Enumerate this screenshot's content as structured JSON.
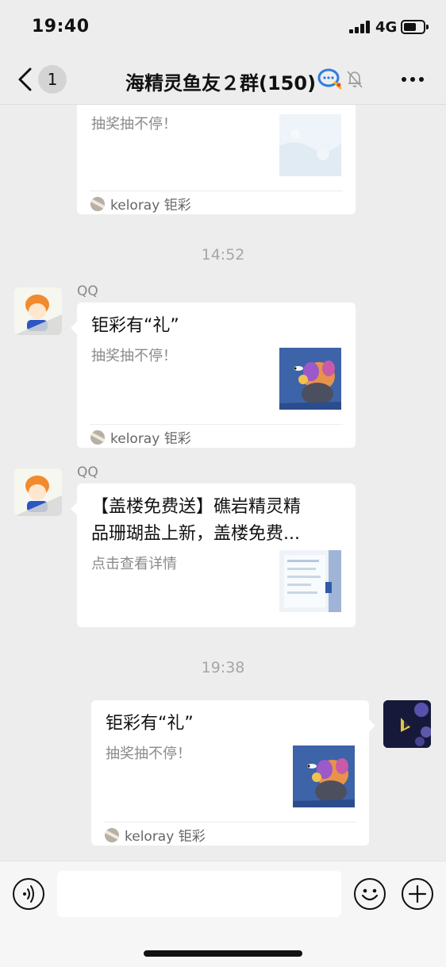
{
  "status_bar": {
    "time": "19:40",
    "network": "4G"
  },
  "nav": {
    "back_badge": "1",
    "title": "海精灵鱼友２群(150)"
  },
  "chat": {
    "messages": [
      {
        "kind": "card-partial",
        "desc": "抽奖抽不停！",
        "footer": "keloray 钜彩"
      },
      {
        "kind": "time",
        "text": "14:52"
      },
      {
        "kind": "card",
        "sender": "QQ",
        "title": "钜彩有“礼”",
        "desc": "抽奖抽不停！",
        "footer": "keloray 钜彩"
      },
      {
        "kind": "card",
        "sender": "QQ",
        "title_line1": "【盖楼免费送】礁岩精灵精",
        "title_line2": "品珊瑚盐上新，盖楼免费...",
        "desc": "点击查看详情"
      },
      {
        "kind": "time",
        "text": "19:38"
      },
      {
        "kind": "card",
        "sender": "me",
        "title": "钜彩有“礼”",
        "desc": "抽奖抽不停！",
        "footer": "keloray 钜彩"
      }
    ]
  },
  "input_bar": {
    "placeholder": ""
  },
  "icons": {
    "back": "chevron-left-icon",
    "qq": "qq-chat-bubble-icon",
    "mute": "bell-slash-icon",
    "more": "ellipsis-icon",
    "voice": "voice-icon",
    "emoji": "smiley-icon",
    "plus": "plus-icon"
  },
  "colors": {
    "background": "#ededed",
    "bubble": "#ffffff",
    "timestamp": "#a6a6a6",
    "thumb_blue": "#3d63a8"
  }
}
